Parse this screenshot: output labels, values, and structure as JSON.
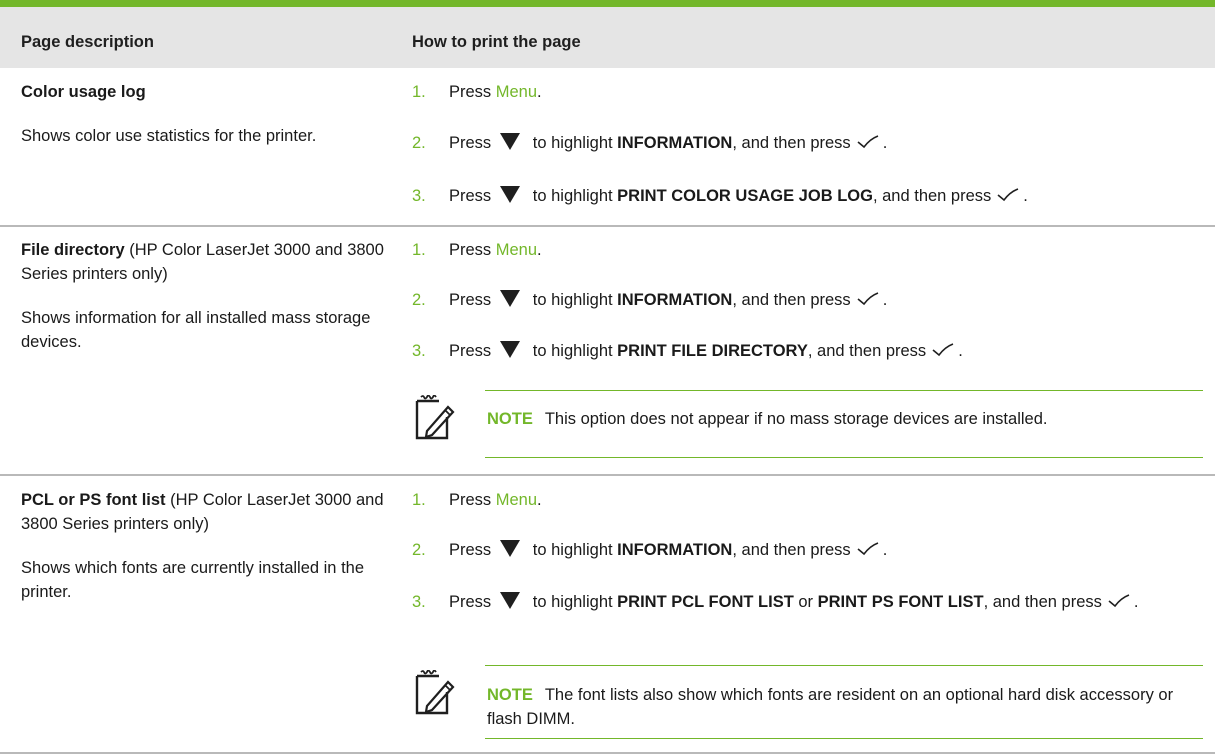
{
  "header": {
    "col1": "Page description",
    "col2": "How to print the page"
  },
  "rows": [
    {
      "title": "Color usage log",
      "title_suffix": "",
      "description": "Shows color use statistics for the printer.",
      "steps": [
        {
          "num": "1.",
          "pre": "Press ",
          "link": "Menu",
          "post": "."
        },
        {
          "num": "2.",
          "pre": "Press",
          "mid": " to highlight ",
          "bold": "INFORMATION",
          "post": ", and then press"
        },
        {
          "num": "3.",
          "pre": "Press",
          "mid": " to highlight ",
          "bold": "PRINT COLOR USAGE JOB LOG",
          "post": ", and then press"
        }
      ]
    },
    {
      "title": "File directory",
      "title_suffix": " (HP Color LaserJet 3000 and 3800 Series printers only)",
      "description": "Shows information for all installed mass storage devices.",
      "steps": [
        {
          "num": "1.",
          "pre": "Press ",
          "link": "Menu",
          "post": "."
        },
        {
          "num": "2.",
          "pre": "Press",
          "mid": " to highlight ",
          "bold": "INFORMATION",
          "post": ", and then press"
        },
        {
          "num": "3.",
          "pre": "Press",
          "mid": " to highlight ",
          "bold": "PRINT FILE DIRECTORY",
          "post": ", and then press"
        }
      ],
      "note_label": "NOTE",
      "note_text": "This option does not appear if no mass storage devices are installed."
    },
    {
      "title": "PCL or PS font list",
      "title_suffix": " (HP Color LaserJet 3000 and 3800 Series printers only)",
      "description": "Shows which fonts are currently installed in the printer.",
      "steps": [
        {
          "num": "1.",
          "pre": "Press ",
          "link": "Menu",
          "post": "."
        },
        {
          "num": "2.",
          "pre": "Press",
          "mid": " to highlight ",
          "bold": "INFORMATION",
          "post": ", and then press"
        },
        {
          "num": "3.",
          "pre": "Press",
          "mid": " to highlight ",
          "bold": "PRINT PCL FONT LIST",
          "mid2": " or ",
          "bold2": "PRINT PS FONT LIST",
          "post": ", and then press"
        }
      ],
      "note_label": "NOTE",
      "note_text": "The font lists also show which fonts are resident on an optional hard disk accessory or flash DIMM."
    }
  ],
  "icons": {
    "down": "down-arrow-icon",
    "ok": "checkmark-icon",
    "note": "note-pencil-icon"
  },
  "colors": {
    "accent": "#73b72a",
    "header_bg": "#e5e5e5"
  }
}
